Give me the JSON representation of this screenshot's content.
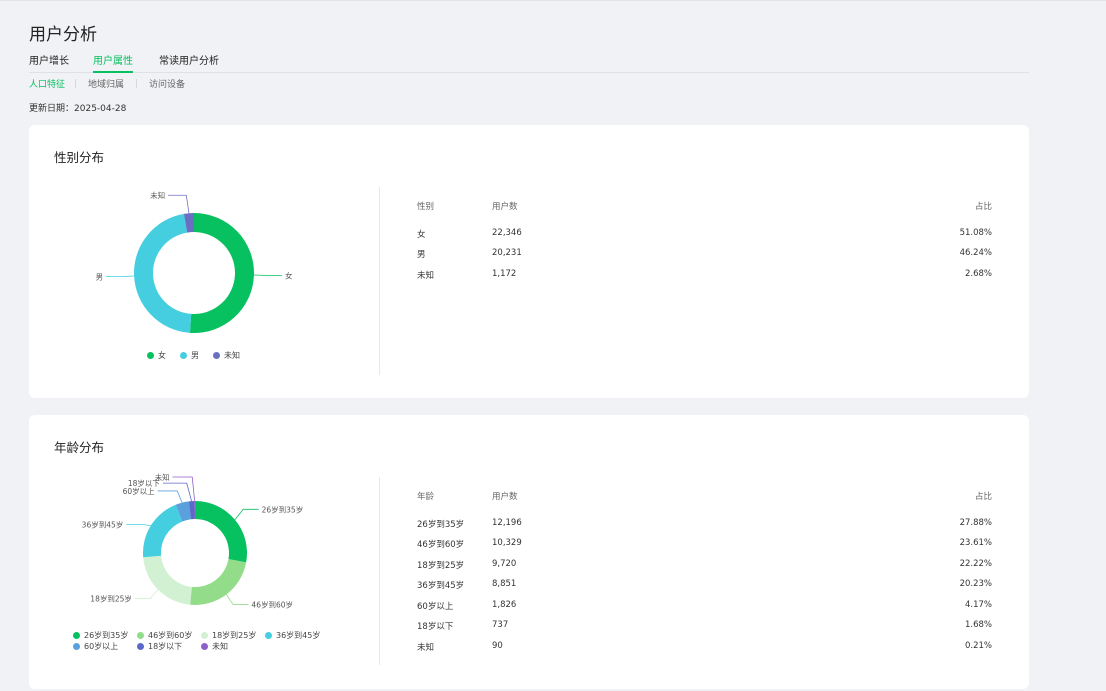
{
  "page": {
    "title": "用户分析",
    "update_label": "更新日期：",
    "update_date": "2025-04-28"
  },
  "tabs": [
    {
      "label": "用户增长",
      "active": false
    },
    {
      "label": "用户属性",
      "active": true
    },
    {
      "label": "常读用户分析",
      "active": false
    }
  ],
  "subtabs": [
    {
      "label": "人口特征",
      "active": true
    },
    {
      "label": "地域归属",
      "active": false
    },
    {
      "label": "访问设备",
      "active": false
    }
  ],
  "gender": {
    "title": "性别分布",
    "headers": {
      "col1": "性别",
      "col2": "用户数",
      "col3": "占比"
    },
    "rows": [
      {
        "name": "女",
        "count": "22,346",
        "ratio": "51.08%"
      },
      {
        "name": "男",
        "count": "20,231",
        "ratio": "46.24%"
      },
      {
        "name": "未知",
        "count": "1,172",
        "ratio": "2.68%"
      }
    ]
  },
  "age": {
    "title": "年龄分布",
    "headers": {
      "col1": "年龄",
      "col2": "用户数",
      "col3": "占比"
    },
    "rows": [
      {
        "name": "26岁到35岁",
        "count": "12,196",
        "ratio": "27.88%"
      },
      {
        "name": "46岁到60岁",
        "count": "10,329",
        "ratio": "23.61%"
      },
      {
        "name": "18岁到25岁",
        "count": "9,720",
        "ratio": "22.22%"
      },
      {
        "name": "36岁到45岁",
        "count": "8,851",
        "ratio": "20.23%"
      },
      {
        "name": "60岁以上",
        "count": "1,826",
        "ratio": "4.17%"
      },
      {
        "name": "18岁以下",
        "count": "737",
        "ratio": "1.68%"
      },
      {
        "name": "未知",
        "count": "90",
        "ratio": "0.21%"
      }
    ]
  },
  "chart_data": [
    {
      "type": "pie",
      "categories": [
        "女",
        "男",
        "未知"
      ],
      "values": [
        22346,
        20231,
        1172
      ],
      "colors": [
        "#07c160",
        "#45cee0",
        "#6a6fc4"
      ],
      "legend_position": "bottom"
    },
    {
      "type": "pie",
      "categories": [
        "26岁到35岁",
        "46岁到60岁",
        "18岁到25岁",
        "36岁到45岁",
        "60岁以上",
        "18岁以下",
        "未知"
      ],
      "values": [
        12196,
        10329,
        9720,
        8851,
        1826,
        737,
        90
      ],
      "colors": [
        "#07c160",
        "#93dc89",
        "#d2f0d2",
        "#45cee0",
        "#5aa0dc",
        "#5b69c9",
        "#8e5fc8"
      ],
      "legend_position": "bottom"
    }
  ]
}
